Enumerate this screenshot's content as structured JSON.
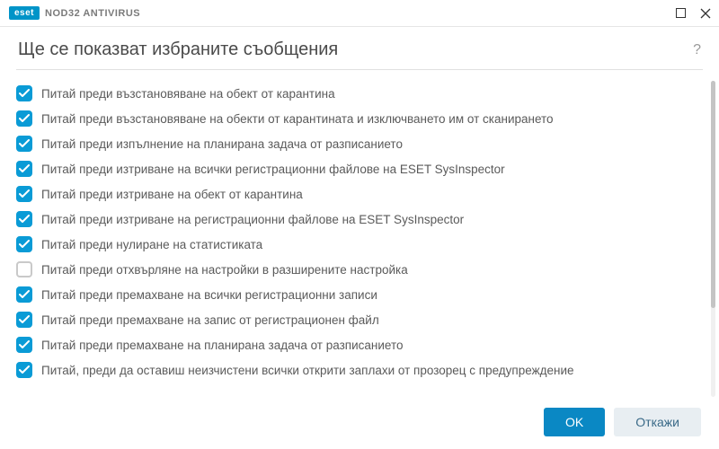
{
  "titlebar": {
    "brand": "eset",
    "product": "NOD32 ANTIVIRUS"
  },
  "header": {
    "title": "Ще се показват избраните съобщения"
  },
  "items": [
    {
      "label": "Питай преди възстановяване на обект от карантина",
      "checked": true
    },
    {
      "label": "Питай преди възстановяване на обекти от карантината и изключването им от сканирането",
      "checked": true
    },
    {
      "label": "Питай преди изпълнение на планирана задача от разписанието",
      "checked": true
    },
    {
      "label": "Питай преди изтриване на всички регистрационни файлове на ESET SysInspector",
      "checked": true
    },
    {
      "label": "Питай преди изтриване на обект от карантина",
      "checked": true
    },
    {
      "label": "Питай преди изтриване на регистрационни файлове на ESET SysInspector",
      "checked": true
    },
    {
      "label": "Питай преди нулиране на статистиката",
      "checked": true
    },
    {
      "label": "Питай преди отхвърляне на настройки в разширените настройка",
      "checked": false
    },
    {
      "label": "Питай преди премахване на всички регистрационни записи",
      "checked": true
    },
    {
      "label": "Питай преди премахване на запис от регистрационен файл",
      "checked": true
    },
    {
      "label": "Питай преди премахване на планирана задача от разписанието",
      "checked": true
    },
    {
      "label": "Питай, преди да оставиш неизчистени всички открити заплахи от прозорец с предупреждение",
      "checked": true
    }
  ],
  "footer": {
    "ok_label": "OK",
    "cancel_label": "Откажи"
  }
}
